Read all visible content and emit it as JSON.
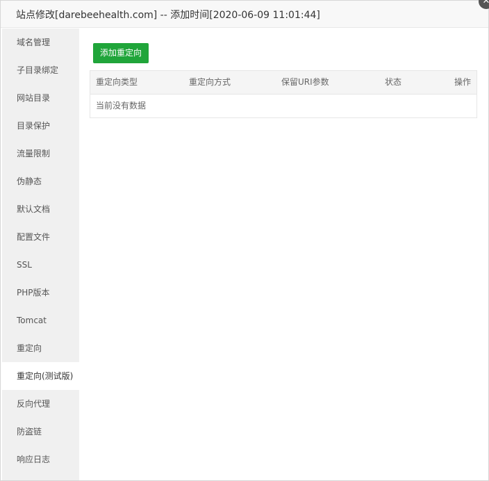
{
  "window": {
    "title": "站点修改[darebeehealth.com] -- 添加时间[2020-06-09 11:01:44]",
    "close_icon": "close-icon"
  },
  "sidebar": {
    "items": [
      {
        "label": "域名管理"
      },
      {
        "label": "子目录绑定"
      },
      {
        "label": "网站目录"
      },
      {
        "label": "目录保护"
      },
      {
        "label": "流量限制"
      },
      {
        "label": "伪静态"
      },
      {
        "label": "默认文档"
      },
      {
        "label": "配置文件"
      },
      {
        "label": "SSL"
      },
      {
        "label": "PHP版本"
      },
      {
        "label": "Tomcat"
      },
      {
        "label": "重定向"
      },
      {
        "label": "重定向(测试版)",
        "active": true
      },
      {
        "label": "反向代理"
      },
      {
        "label": "防盗链"
      },
      {
        "label": "响应日志"
      }
    ]
  },
  "main": {
    "add_button_label": "添加重定向",
    "table": {
      "columns": [
        "重定向类型",
        "重定向方式",
        "保留URI参数",
        "状态",
        "操作"
      ],
      "empty_text": "当前没有数据"
    }
  },
  "colors": {
    "accent": "#20a53a",
    "sidebar_bg": "#f0f0f0",
    "titlebar_bg": "#f8f8f8"
  }
}
